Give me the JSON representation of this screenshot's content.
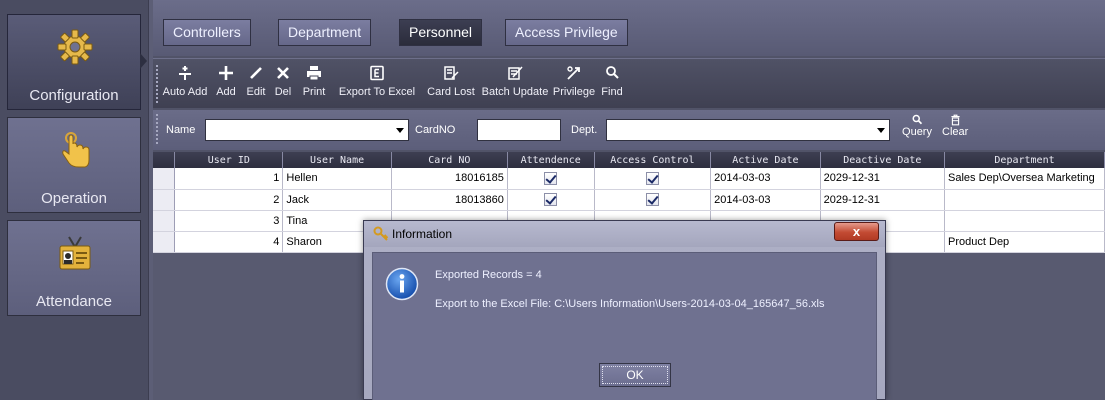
{
  "sidebar": {
    "items": [
      {
        "label": "Configuration",
        "icon": "gear-icon",
        "active": true
      },
      {
        "label": "Operation",
        "icon": "hand-pointer-icon",
        "active": false
      },
      {
        "label": "Attendance",
        "icon": "id-card-icon",
        "active": false
      }
    ]
  },
  "tabs": [
    {
      "label": "Controllers",
      "active": false
    },
    {
      "label": "Department",
      "active": false
    },
    {
      "label": "Personnel",
      "active": true
    },
    {
      "label": "Access Privilege",
      "active": false
    }
  ],
  "toolbar": {
    "buttons": [
      {
        "label": "Auto Add",
        "icon": "auto-add-icon"
      },
      {
        "label": "Add",
        "icon": "plus-icon"
      },
      {
        "label": "Edit",
        "icon": "pencil-icon"
      },
      {
        "label": "Del",
        "icon": "x-icon"
      },
      {
        "label": "Print",
        "icon": "printer-icon"
      },
      {
        "label": "Export To Excel",
        "icon": "excel-icon"
      },
      {
        "label": "Card Lost",
        "icon": "card-lost-icon"
      },
      {
        "label": "Batch Update",
        "icon": "batch-update-icon"
      },
      {
        "label": "Privilege",
        "icon": "privilege-icon"
      },
      {
        "label": "Find",
        "icon": "search-icon"
      }
    ]
  },
  "filter": {
    "name_label": "Name",
    "name_value": "",
    "cardno_label": "CardNO",
    "cardno_value": "",
    "dept_label": "Dept.",
    "dept_value": "",
    "query_label": "Query",
    "clear_label": "Clear"
  },
  "grid": {
    "columns": [
      "User ID",
      "User Name",
      "Card NO",
      "Attendence",
      "Access Control",
      "Active Date",
      "Deactive Date",
      "Department"
    ],
    "rows": [
      {
        "id": "1",
        "name": "Hellen",
        "card": "18016185",
        "attendence": true,
        "access": true,
        "active": "2014-03-03",
        "deactive": "2029-12-31",
        "dept": "Sales Dep\\Oversea Marketing"
      },
      {
        "id": "2",
        "name": "Jack",
        "card": "18013860",
        "attendence": true,
        "access": true,
        "active": "2014-03-03",
        "deactive": "2029-12-31",
        "dept": ""
      },
      {
        "id": "3",
        "name": "Tina",
        "card": "",
        "attendence": false,
        "access": false,
        "active": "",
        "deactive": "",
        "dept": ""
      },
      {
        "id": "4",
        "name": "Sharon",
        "card": "",
        "attendence": false,
        "access": false,
        "active": "",
        "deactive": "",
        "dept": "Product Dep"
      }
    ]
  },
  "dialog": {
    "title": "Information",
    "line1": "Exported Records = 4",
    "line2": "Export to the Excel File: C:\\Users Information\\Users-2014-03-04_165647_56.xls",
    "ok_label": "OK",
    "close_label": "x"
  },
  "colors": {
    "background": "#4b4d63",
    "dialog_body": "#6f7190",
    "close_button": "#c34b33"
  }
}
